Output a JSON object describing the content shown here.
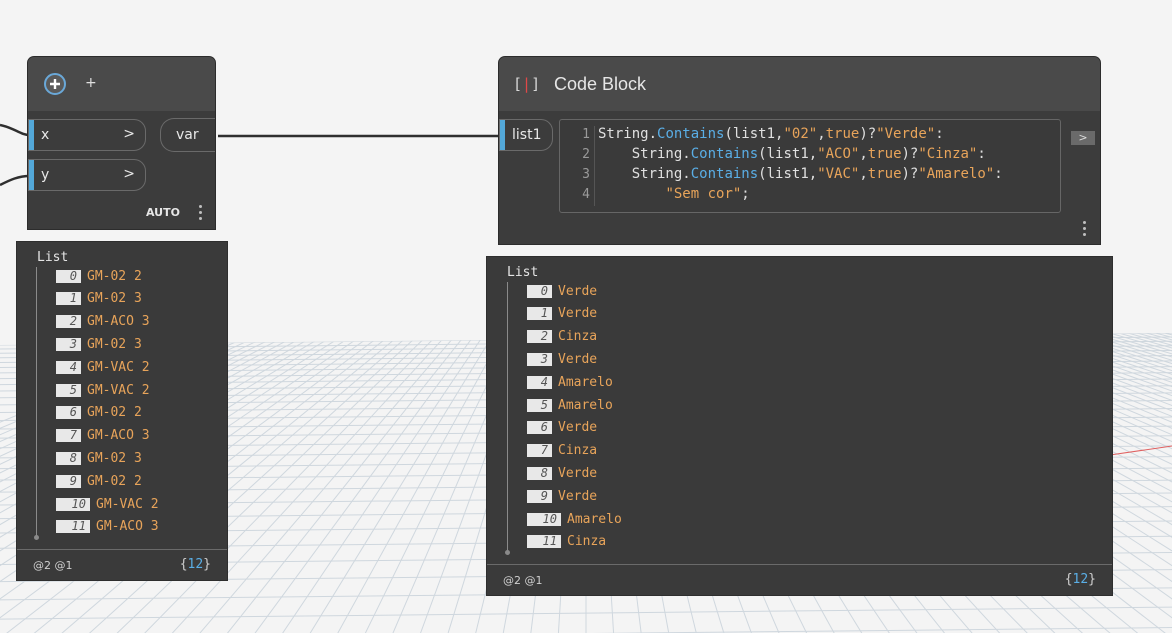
{
  "input_node": {
    "icon": "plus-icon",
    "title": "+",
    "inputs": [
      {
        "label": "x",
        "arrow": ">"
      },
      {
        "label": "y",
        "arrow": ">"
      }
    ],
    "output": "var",
    "lacing": "AUTO",
    "preview": {
      "title": "List",
      "items": [
        {
          "index": "0",
          "value": "GM-02 2"
        },
        {
          "index": "1",
          "value": "GM-02 3"
        },
        {
          "index": "2",
          "value": "GM-ACO 3"
        },
        {
          "index": "3",
          "value": "GM-02 3"
        },
        {
          "index": "4",
          "value": "GM-VAC 2"
        },
        {
          "index": "5",
          "value": "GM-VAC 2"
        },
        {
          "index": "6",
          "value": "GM-02 2"
        },
        {
          "index": "7",
          "value": "GM-ACO 3"
        },
        {
          "index": "8",
          "value": "GM-02 3"
        },
        {
          "index": "9",
          "value": "GM-02 2"
        },
        {
          "index": "10",
          "value": "GM-VAC 2"
        },
        {
          "index": "11",
          "value": "GM-ACO 3"
        }
      ],
      "levels": "@2 @1",
      "count_open": "{",
      "count": "12",
      "count_close": "}"
    }
  },
  "code_block": {
    "icon": "code-block-icon",
    "title": "Code Block",
    "input": "list1",
    "output_arrow": ">",
    "code_lines": [
      {
        "num": "1",
        "indent": "",
        "parts": [
          [
            "kw",
            "String."
          ],
          [
            "fn",
            "Contains"
          ],
          [
            "kw",
            "(list1,"
          ],
          [
            "str",
            "\"02\""
          ],
          [
            "kw",
            ","
          ],
          [
            "bool",
            "true"
          ],
          [
            "kw",
            ")?"
          ],
          [
            "str",
            "\"Verde\""
          ],
          [
            "kw",
            ":"
          ]
        ]
      },
      {
        "num": "2",
        "indent": "    ",
        "parts": [
          [
            "kw",
            "String."
          ],
          [
            "fn",
            "Contains"
          ],
          [
            "kw",
            "(list1,"
          ],
          [
            "str",
            "\"ACO\""
          ],
          [
            "kw",
            ","
          ],
          [
            "bool",
            "true"
          ],
          [
            "kw",
            ")?"
          ],
          [
            "str",
            "\"Cinza\""
          ],
          [
            "kw",
            ":"
          ]
        ]
      },
      {
        "num": "3",
        "indent": "    ",
        "parts": [
          [
            "kw",
            "String."
          ],
          [
            "fn",
            "Contains"
          ],
          [
            "kw",
            "(list1,"
          ],
          [
            "str",
            "\"VAC\""
          ],
          [
            "kw",
            ","
          ],
          [
            "bool",
            "true"
          ],
          [
            "kw",
            ")?"
          ],
          [
            "str",
            "\"Amarelo\""
          ],
          [
            "kw",
            ":"
          ]
        ]
      },
      {
        "num": "4",
        "indent": "        ",
        "parts": [
          [
            "str",
            "\"Sem cor\""
          ],
          [
            "kw",
            ";"
          ]
        ]
      }
    ],
    "preview": {
      "title": "List",
      "items": [
        {
          "index": "0",
          "value": "Verde"
        },
        {
          "index": "1",
          "value": "Verde"
        },
        {
          "index": "2",
          "value": "Cinza"
        },
        {
          "index": "3",
          "value": "Verde"
        },
        {
          "index": "4",
          "value": "Amarelo"
        },
        {
          "index": "5",
          "value": "Amarelo"
        },
        {
          "index": "6",
          "value": "Verde"
        },
        {
          "index": "7",
          "value": "Cinza"
        },
        {
          "index": "8",
          "value": "Verde"
        },
        {
          "index": "9",
          "value": "Verde"
        },
        {
          "index": "10",
          "value": "Amarelo"
        },
        {
          "index": "11",
          "value": "Cinza"
        }
      ],
      "levels": "@2 @1",
      "count_open": "{",
      "count": "12",
      "count_close": "}"
    }
  },
  "colors": {
    "port_accent": "#53a8d9",
    "value_text": "#e8a45a",
    "count_text": "#5aaee6"
  }
}
